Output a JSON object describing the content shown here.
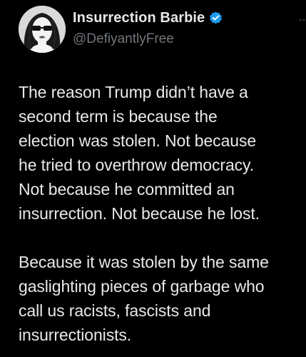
{
  "author": {
    "display_name": "Insurrection Barbie",
    "handle": "@DefiyantlyFree",
    "verified": true,
    "avatar_icon": "woman-with-sunglasses-avatar",
    "verified_color": "#1d9bf0"
  },
  "tweet": {
    "paragraphs": [
      "The reason Trump didn’t have a\nsecond term is because the\nelection was stolen. Not because\nhe tried to overthrow democracy.\nNot because he committed an\ninsurrection. Not because he lost.",
      "Because it was stolen by the same\ngaslighting pieces of garbage who\ncall us racists, fascists and\ninsurrectionists."
    ]
  },
  "colors": {
    "background": "#000000",
    "text_primary": "#e7e9ea",
    "text_secondary": "#71767b"
  }
}
